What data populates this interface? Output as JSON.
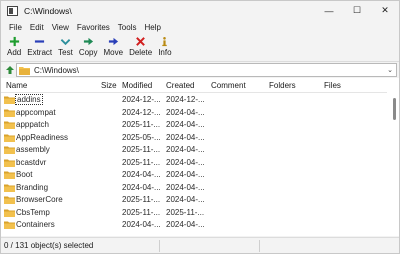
{
  "window": {
    "title": "C:\\Windows\\",
    "icon": "archive-app-icon",
    "controls": {
      "minimize": "—",
      "maximize": "☐",
      "close": "✕"
    }
  },
  "menu": {
    "items": [
      "File",
      "Edit",
      "View",
      "Favorites",
      "Tools",
      "Help"
    ]
  },
  "toolbar": {
    "items": [
      {
        "label": "Add",
        "icon": "plus-icon",
        "color": "#1f9d2f"
      },
      {
        "label": "Extract",
        "icon": "minus-icon",
        "color": "#2a3fb8"
      },
      {
        "label": "Test",
        "icon": "check-icon",
        "color": "#2d8f9c"
      },
      {
        "label": "Copy",
        "icon": "arrow-right-icon",
        "color": "#1f8a55"
      },
      {
        "label": "Move",
        "icon": "arrow-right-icon",
        "color": "#2a3fb8"
      },
      {
        "label": "Delete",
        "icon": "x-icon",
        "color": "#d11f1f"
      },
      {
        "label": "Info",
        "icon": "info-icon",
        "color": "#b98a12"
      }
    ]
  },
  "address": {
    "value": "C:\\Windows\\"
  },
  "columns": {
    "name": "Name",
    "size": "Size",
    "modified": "Modified",
    "created": "Created",
    "comment": "Comment",
    "folders": "Folders",
    "files": "Files"
  },
  "rows": [
    {
      "name": "addins",
      "modified": "2024-12-...",
      "created": "2024-12-..."
    },
    {
      "name": "appcompat",
      "modified": "2024-12-...",
      "created": "2024-04-..."
    },
    {
      "name": "apppatch",
      "modified": "2025-11-...",
      "created": "2024-04-..."
    },
    {
      "name": "AppReadiness",
      "modified": "2025-05-...",
      "created": "2024-04-..."
    },
    {
      "name": "assembly",
      "modified": "2025-11-...",
      "created": "2024-04-..."
    },
    {
      "name": "bcastdvr",
      "modified": "2025-11-...",
      "created": "2024-04-..."
    },
    {
      "name": "Boot",
      "modified": "2024-04-...",
      "created": "2024-04-..."
    },
    {
      "name": "Branding",
      "modified": "2024-04-...",
      "created": "2024-04-..."
    },
    {
      "name": "BrowserCore",
      "modified": "2025-11-...",
      "created": "2024-04-..."
    },
    {
      "name": "CbsTemp",
      "modified": "2025-11-...",
      "created": "2025-11-..."
    },
    {
      "name": "Containers",
      "modified": "2024-04-...",
      "created": "2024-04-..."
    }
  ],
  "status": {
    "text": "0 / 131 object(s) selected"
  },
  "colors": {
    "folder": "#f2c14e",
    "folder_dark": "#d9a22a"
  }
}
